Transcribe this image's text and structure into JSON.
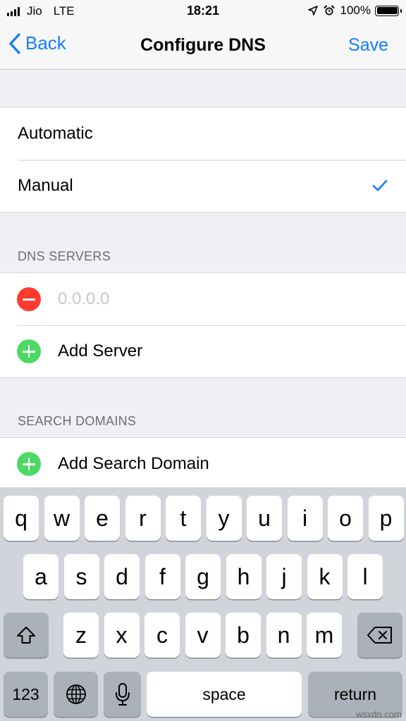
{
  "status_bar": {
    "carrier": "Jio",
    "network": "LTE",
    "time": "18:21",
    "battery": "100%",
    "icons": [
      "signal-icon",
      "location-icon",
      "alarm-icon",
      "battery-icon"
    ]
  },
  "nav": {
    "back_label": "Back",
    "title": "Configure DNS",
    "save_label": "Save"
  },
  "mode_options": [
    {
      "label": "Automatic",
      "selected": false
    },
    {
      "label": "Manual",
      "selected": true
    }
  ],
  "dns_servers": {
    "header": "DNS SERVERS",
    "server_placeholder": "0.0.0.0",
    "add_label": "Add Server"
  },
  "search_domains": {
    "header": "SEARCH DOMAINS",
    "add_label": "Add Search Domain"
  },
  "keyboard": {
    "row1": [
      "q",
      "w",
      "e",
      "r",
      "t",
      "y",
      "u",
      "i",
      "o",
      "p"
    ],
    "row2": [
      "a",
      "s",
      "d",
      "f",
      "g",
      "h",
      "j",
      "k",
      "l"
    ],
    "row3": [
      "z",
      "x",
      "c",
      "v",
      "b",
      "n",
      "m"
    ],
    "numbers_label": "123",
    "space_label": "space",
    "return_label": "return"
  },
  "watermark": "wsxdn.com",
  "colors": {
    "accent": "#147efb",
    "delete": "#ff3b30",
    "add": "#4cd964",
    "background": "#efeff4"
  }
}
